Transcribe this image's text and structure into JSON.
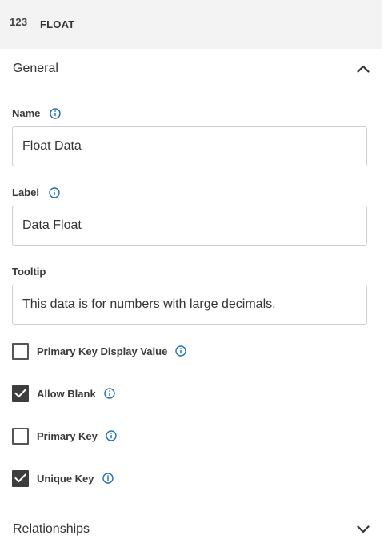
{
  "header": {
    "type_icon": "123",
    "type_label": "FLOAT"
  },
  "general": {
    "title": "General",
    "toggle_icon": "chevron-up-icon"
  },
  "fields": {
    "name": {
      "label": "Name",
      "value": "Float Data",
      "info_icon": "info-icon"
    },
    "label": {
      "label": "Label",
      "value": "Data Float",
      "info_icon": "info-icon"
    },
    "tooltip": {
      "label": "Tooltip",
      "value": "This data is for numbers with large decimals."
    }
  },
  "checkboxes": [
    {
      "label": "Primary Key Display Value",
      "checked": false
    },
    {
      "label": "Allow Blank",
      "checked": true
    },
    {
      "label": "Primary Key",
      "checked": false
    },
    {
      "label": "Unique Key",
      "checked": true
    }
  ],
  "relationships": {
    "title": "Relationships",
    "toggle_icon": "chevron-down-icon"
  },
  "colors": {
    "header_bg": "#f3f3f3",
    "info_blue": "#1f6fb5",
    "checkbox_checked": "#3d3d3d"
  }
}
